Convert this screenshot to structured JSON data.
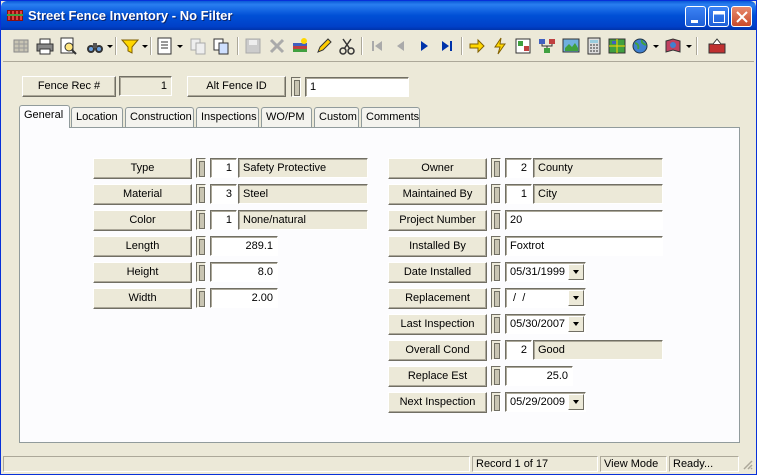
{
  "window": {
    "title": "Street Fence Inventory - No Filter",
    "accent": "#0a5ad8"
  },
  "header": {
    "fence_rec_label": "Fence Rec #",
    "fence_rec_value": "1",
    "alt_id_label": "Alt Fence ID",
    "alt_id_value": "1"
  },
  "tabs": [
    {
      "label": "General",
      "active": true
    },
    {
      "label": "Location"
    },
    {
      "label": "Construction"
    },
    {
      "label": "Inspections"
    },
    {
      "label": "WO/PM"
    },
    {
      "label": "Custom"
    },
    {
      "label": "Comments"
    }
  ],
  "left": {
    "type": {
      "label": "Type",
      "code": "1",
      "desc": "Safety Protective"
    },
    "material": {
      "label": "Material",
      "code": "3",
      "desc": "Steel"
    },
    "color": {
      "label": "Color",
      "code": "1",
      "desc": "None/natural"
    },
    "length": {
      "label": "Length",
      "value": "289.1"
    },
    "height": {
      "label": "Height",
      "value": "8.0"
    },
    "width": {
      "label": "Width",
      "value": "2.00"
    }
  },
  "right": {
    "owner": {
      "label": "Owner",
      "code": "2",
      "desc": "County"
    },
    "maintained_by": {
      "label": "Maintained By",
      "code": "1",
      "desc": "City"
    },
    "project_number": {
      "label": "Project Number",
      "value": "20"
    },
    "installed_by": {
      "label": "Installed By",
      "value": "Foxtrot"
    },
    "date_installed": {
      "label": "Date Installed",
      "value": "05/31/1999"
    },
    "replacement": {
      "label": "Replacement",
      "value": " /  /"
    },
    "last_inspection": {
      "label": "Last Inspection",
      "value": "05/30/2007"
    },
    "overall_cond": {
      "label": "Overall Cond",
      "code": "2",
      "desc": "Good"
    },
    "replace_est": {
      "label": "Replace Est",
      "value": "25.0"
    },
    "next_inspection": {
      "label": "Next Inspection",
      "value": "05/29/2009"
    }
  },
  "status": {
    "record": "Record 1 of 17",
    "mode": "View Mode",
    "state": "Ready..."
  }
}
